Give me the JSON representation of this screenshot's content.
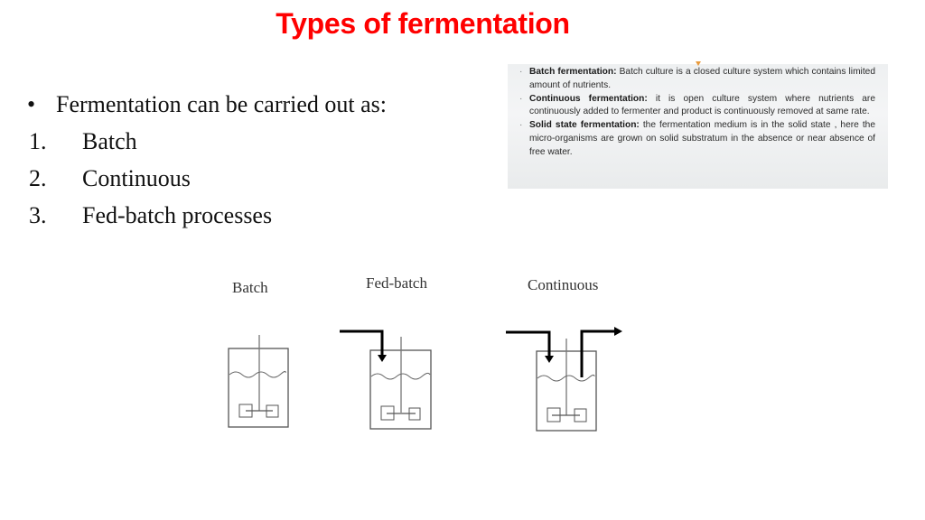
{
  "slide": {
    "title": "Types of fermentation",
    "title_color": "#ff0000"
  },
  "list": {
    "intro": "Fermentation can be carried out as:",
    "bullet_symbol": "•",
    "items": [
      {
        "number": "1.",
        "label": "Batch"
      },
      {
        "number": "2.",
        "label": "Continuous"
      },
      {
        "number": "3.",
        "label": "Fed-batch processes"
      }
    ]
  },
  "infobox": {
    "items": [
      {
        "term": "Batch fermentation:",
        "text": " Batch culture is a closed  culture system which contains limited amount of nutrients."
      },
      {
        "term": "Continuous fermentation:",
        "text": " it is open culture system where nutrients are continuously added to fermenter and product is continuously removed at same rate."
      },
      {
        "term": "Solid state fermentation:",
        "text": " the fermentation medium is in the solid state , here the micro-organisms are grown on solid substratum in the absence or near absence of free water."
      }
    ]
  },
  "diagram": {
    "vessels": [
      {
        "label": "Batch",
        "inlet": false,
        "outlet": false
      },
      {
        "label": "Fed-batch",
        "inlet": true,
        "outlet": false
      },
      {
        "label": "Continuous",
        "inlet": true,
        "outlet": true
      }
    ]
  }
}
